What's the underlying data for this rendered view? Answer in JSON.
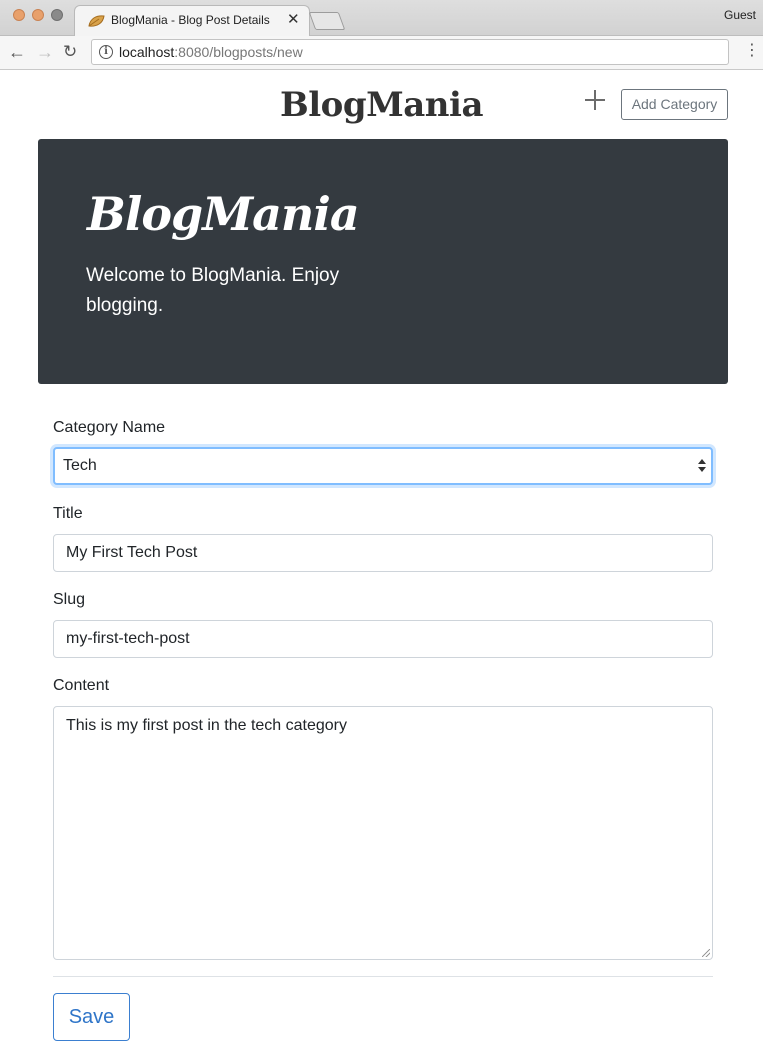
{
  "browser": {
    "tab_title": "BlogMania - Blog Post Details",
    "tab_close": "✕",
    "profile": "Guest",
    "url_host": "localhost",
    "url_rest": ":8080/blogposts/new",
    "back": "←",
    "forward": "→",
    "reload": "↻",
    "menu": "⋮",
    "info": "i"
  },
  "header": {
    "brand": "BlogMania",
    "add_category_label": "Add Category",
    "plus_icon": "plus-icon"
  },
  "jumbotron": {
    "title": "BlogMania",
    "lead": "Welcome to BlogMania. Enjoy blogging."
  },
  "form": {
    "category_label": "Category Name",
    "category_value": "Tech",
    "title_label": "Title",
    "title_value": "My First Tech Post",
    "slug_label": "Slug",
    "slug_value": "my-first-tech-post",
    "content_label": "Content",
    "content_value": "This is my first post in the tech category",
    "save_label": "Save"
  },
  "colors": {
    "jumbotron_bg": "#343a40",
    "focus_border": "#80bdff",
    "primary": "#2f75c8",
    "secondary": "#6c757d"
  }
}
